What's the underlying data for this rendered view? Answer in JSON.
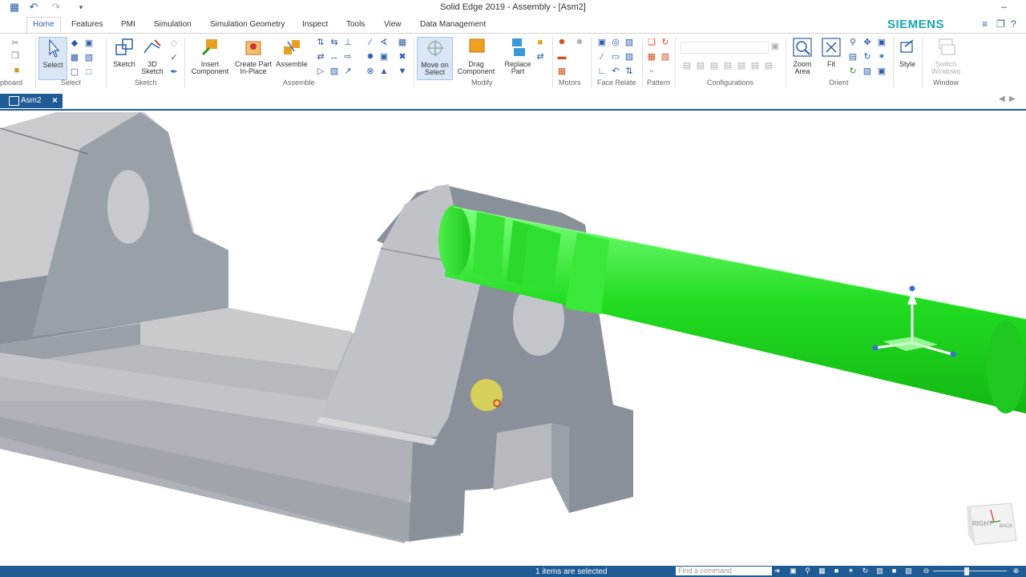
{
  "window": {
    "title": "Solid Edge 2019 - Assembly - [Asm2]",
    "brand": "SIEMENS"
  },
  "tabs": [
    "Home",
    "Features",
    "PMI",
    "Simulation",
    "Simulation Geometry",
    "Inspect",
    "Tools",
    "View",
    "Data Management"
  ],
  "ribbon": {
    "clipboard_label": "pboard",
    "select": {
      "label": "Select",
      "group": "Select"
    },
    "sketch": {
      "sketch": "Sketch",
      "sketch3d_1": "3D",
      "sketch3d_2": "Sketch",
      "group": "Sketch"
    },
    "assemble": {
      "insert_1": "Insert",
      "insert_2": "Component",
      "create_1": "Create Part",
      "create_2": "In-Place",
      "assemble": "Assemble",
      "group": "Assemble"
    },
    "modify": {
      "move_1": "Move on",
      "move_2": "Select",
      "drag_1": "Drag",
      "drag_2": "Component",
      "replace_1": "Replace",
      "replace_2": "Part",
      "group": "Modify"
    },
    "motors_group": "Motors",
    "face_relate_group": "Face Relate",
    "pattern_group": "Pattern",
    "configurations_group": "Configurations",
    "orient": {
      "zoom_1": "Zoom",
      "zoom_2": "Area",
      "fit": "Fit",
      "group": "Orient"
    },
    "style": "Style",
    "window": {
      "switch_1": "Switch",
      "switch_2": "Windows",
      "group": "Window"
    }
  },
  "document_tab": "Asm2",
  "viewcube": {
    "right": "RIGHT",
    "back": "BACK"
  },
  "status": {
    "message": "1 items are selected",
    "find_placeholder": "Find a command"
  },
  "colors": {
    "accent": "#1f5b94",
    "brand": "#1aa3b3",
    "selected_part": "#22dd22",
    "model_gray": "#a4a8ae"
  }
}
